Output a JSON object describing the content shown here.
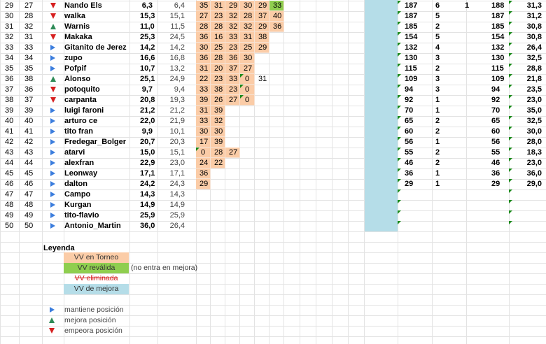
{
  "rows": [
    {
      "n": "29",
      "p": "27",
      "trend": "down",
      "name": "Nando Els",
      "a": "6,3",
      "b": "6,4",
      "c": "31,3",
      "vv": [
        "35",
        "31",
        "29",
        "30",
        "29",
        "33"
      ],
      "highlight": 5,
      "r": {
        "v": "187",
        "w": "6",
        "x": "1",
        "y": "188"
      }
    },
    {
      "n": "30",
      "p": "28",
      "trend": "down",
      "name": "walka",
      "a": "15,3",
      "b": "15,1",
      "c": "31,2",
      "vv": [
        "27",
        "23",
        "32",
        "28",
        "37",
        "40"
      ],
      "r": {
        "v": "187",
        "w": "5",
        "x": "",
        "y": "187"
      }
    },
    {
      "n": "31",
      "p": "32",
      "trend": "up",
      "name": "Warnis",
      "a": "11,0",
      "b": "11,5",
      "c": "30,8",
      "vv": [
        "28",
        "28",
        "32",
        "32",
        "29",
        "36"
      ],
      "vvcount": 5,
      "r": {
        "v": "185",
        "w": "2",
        "x": "",
        "y": "185"
      }
    },
    {
      "n": "32",
      "p": "31",
      "trend": "down",
      "name": "Makaka",
      "a": "25,3",
      "b": "24,5",
      "c": "30,8",
      "vv": [
        "36",
        "16",
        "33",
        "31",
        "38"
      ],
      "vvcount": 4,
      "r": {
        "v": "154",
        "w": "5",
        "x": "",
        "y": "154"
      }
    },
    {
      "n": "33",
      "p": "33",
      "trend": "same",
      "name": "Gitanito de Jerez",
      "a": "14,2",
      "b": "14,2",
      "c": "26,4",
      "vv": [
        "30",
        "25",
        "23",
        "25",
        "29"
      ],
      "r": {
        "v": "132",
        "w": "4",
        "x": "",
        "y": "132"
      }
    },
    {
      "n": "34",
      "p": "34",
      "trend": "same",
      "name": "zupo",
      "a": "16,6",
      "b": "16,8",
      "c": "32,5",
      "vv": [
        "36",
        "28",
        "36",
        "30"
      ],
      "r": {
        "v": "130",
        "w": "3",
        "x": "",
        "y": "130"
      }
    },
    {
      "n": "35",
      "p": "35",
      "trend": "same",
      "name": "Pofpif",
      "a": "10,7",
      "b": "13,2",
      "c": "28,8",
      "vv": [
        "31",
        "20",
        "37",
        "27"
      ],
      "r": {
        "v": "115",
        "w": "2",
        "x": "",
        "y": "115"
      }
    },
    {
      "n": "36",
      "p": "38",
      "trend": "up",
      "name": "Alonso",
      "a": "25,1",
      "b": "24,9",
      "c": "21,8",
      "vv": [
        "22",
        "23",
        "33",
        "0",
        "31"
      ],
      "vvcount": 3,
      "flagcol": 3,
      "r": {
        "v": "109",
        "w": "3",
        "x": "",
        "y": "109"
      }
    },
    {
      "n": "37",
      "p": "36",
      "trend": "down",
      "name": "potoquito",
      "a": "9,7",
      "b": "9,4",
      "c": "23,5",
      "vv": [
        "33",
        "38",
        "23",
        "0"
      ],
      "flagcol": 3,
      "r": {
        "v": "94",
        "w": "3",
        "x": "",
        "y": "94"
      }
    },
    {
      "n": "38",
      "p": "37",
      "trend": "down",
      "name": "carpanta",
      "a": "20,8",
      "b": "19,3",
      "c": "23,0",
      "vv": [
        "39",
        "26",
        "27",
        "0"
      ],
      "flagcol": 3,
      "r": {
        "v": "92",
        "w": "1",
        "x": "",
        "y": "92"
      }
    },
    {
      "n": "39",
      "p": "39",
      "trend": "same",
      "name": "luigi faroni",
      "a": "21,2",
      "b": "21,2",
      "c": "35,0",
      "vv": [
        "31",
        "39"
      ],
      "r": {
        "v": "70",
        "w": "1",
        "x": "",
        "y": "70"
      }
    },
    {
      "n": "40",
      "p": "40",
      "trend": "same",
      "name": "arturo ce",
      "a": "22,0",
      "b": "21,9",
      "c": "32,5",
      "vv": [
        "33",
        "32"
      ],
      "vvcount": 1,
      "r": {
        "v": "65",
        "w": "2",
        "x": "",
        "y": "65"
      }
    },
    {
      "n": "41",
      "p": "41",
      "trend": "same",
      "name": "tito fran",
      "a": "9,9",
      "b": "10,1",
      "c": "30,0",
      "vv": [
        "30",
        "30"
      ],
      "r": {
        "v": "60",
        "w": "2",
        "x": "",
        "y": "60"
      }
    },
    {
      "n": "42",
      "p": "42",
      "trend": "same",
      "name": "Fredegar_Bolger",
      "a": "20,7",
      "b": "20,3",
      "c": "28,0",
      "vv": [
        "17",
        "39"
      ],
      "r": {
        "v": "56",
        "w": "1",
        "x": "",
        "y": "56"
      }
    },
    {
      "n": "43",
      "p": "43",
      "trend": "same",
      "name": "atarvi",
      "a": "15,0",
      "b": "15,1",
      "c": "18,3",
      "vv": [
        "0",
        "28",
        "27"
      ],
      "vvcount": 2,
      "flagcol": 0,
      "r": {
        "v": "55",
        "w": "2",
        "x": "",
        "y": "55"
      }
    },
    {
      "n": "44",
      "p": "44",
      "trend": "same",
      "name": "alexfran",
      "a": "22,9",
      "b": "23,0",
      "c": "23,0",
      "vv": [
        "24",
        "22"
      ],
      "vvcount": 1,
      "r": {
        "v": "46",
        "w": "2",
        "x": "",
        "y": "46"
      }
    },
    {
      "n": "45",
      "p": "45",
      "trend": "same",
      "name": "Leonway",
      "a": "17,1",
      "b": "17,1",
      "c": "36,0",
      "vv": [
        "36"
      ],
      "vvcount": 0,
      "r": {
        "v": "36",
        "w": "1",
        "x": "",
        "y": "36"
      }
    },
    {
      "n": "46",
      "p": "46",
      "trend": "same",
      "name": "dalton",
      "a": "24,2",
      "b": "24,3",
      "c": "29,0",
      "vv": [
        "29"
      ],
      "r": {
        "v": "29",
        "w": "1",
        "x": "",
        "y": "29"
      }
    },
    {
      "n": "47",
      "p": "47",
      "trend": "same",
      "name": "Campo",
      "a": "14,3",
      "b": "14,3",
      "c": "",
      "vv": [],
      "r": {
        "v": "",
        "w": "",
        "x": "",
        "y": ""
      }
    },
    {
      "n": "48",
      "p": "48",
      "trend": "same",
      "name": "Kurgan",
      "a": "14,9",
      "b": "14,9",
      "c": "",
      "vv": [],
      "r": {
        "v": "",
        "w": "",
        "x": "",
        "y": ""
      }
    },
    {
      "n": "49",
      "p": "49",
      "trend": "same",
      "name": "tito-flavio",
      "a": "25,9",
      "b": "25,9",
      "c": "",
      "vv": [],
      "r": {
        "v": "",
        "w": "",
        "x": "",
        "y": ""
      }
    },
    {
      "n": "50",
      "p": "50",
      "trend": "same",
      "name": "Antonio_Martin",
      "a": "36,0",
      "b": "26,4",
      "c": "",
      "vv": [],
      "r": {
        "v": "",
        "w": "",
        "x": "",
        "y": ""
      }
    }
  ],
  "legend": {
    "title": "Leyenda",
    "torneo": "VV en Torneo",
    "revalida": "VV reválida",
    "revalida_note": "(no entra en mejora)",
    "eliminada": "VV eliminada",
    "mejora": "VV de mejora",
    "same": "mantiene posición",
    "up": "mejora posición",
    "down": "empeora posición"
  },
  "colors": {
    "torneo": "#fbcca7",
    "revalida": "#8fce4f",
    "mejora": "#b5dde8",
    "up": "#2e8b57",
    "down": "#d62020",
    "same": "#3b7ddd"
  }
}
